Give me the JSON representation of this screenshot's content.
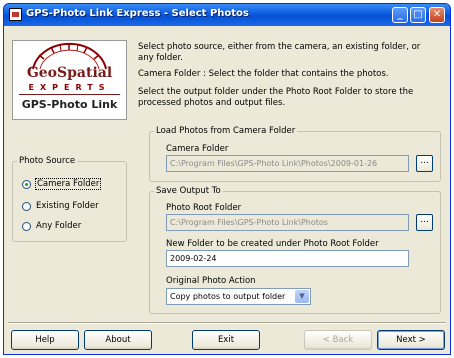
{
  "window": {
    "title": "GPS-Photo Link Express - Select Photos",
    "min_glyph": "_",
    "max_glyph": "□",
    "close_glyph": "✕"
  },
  "logo": {
    "line1": "GeoSpatial",
    "line2": "EXPERTS",
    "line3": "GPS-Photo Link"
  },
  "descriptions": [
    "Select photo source, either from the camera, an existing folder, or any folder.",
    "Camera Folder : Select the folder that contains the photos.",
    "Select the output folder under the Photo Root Folder to store the processed photos and output files."
  ],
  "photo_source": {
    "legend": "Photo Source",
    "options": [
      {
        "label": "Camera Folder",
        "selected": true
      },
      {
        "label": "Existing Folder",
        "selected": false
      },
      {
        "label": "Any Folder",
        "selected": false
      }
    ]
  },
  "load_photos": {
    "legend": "Load Photos from Camera Folder",
    "camera_folder_label": "Camera Folder",
    "camera_folder_value": "C:\\Program Files\\GPS-Photo Link\\Photos\\2009-01-26",
    "browse_label": "..."
  },
  "save_output": {
    "legend": "Save Output To",
    "root_label": "Photo Root Folder",
    "root_value": "C:\\Program Files\\GPS-Photo Link\\Photos",
    "browse_label": "...",
    "new_folder_label": "New Folder to be created under Photo Root Folder",
    "new_folder_value": "2009-02-24",
    "action_label": "Original Photo Action",
    "action_value": "Copy photos to output folder",
    "action_arrow": "▼"
  },
  "buttons": {
    "help": "Help",
    "about": "About",
    "exit": "Exit",
    "back": "< Back",
    "next": "Next >"
  }
}
